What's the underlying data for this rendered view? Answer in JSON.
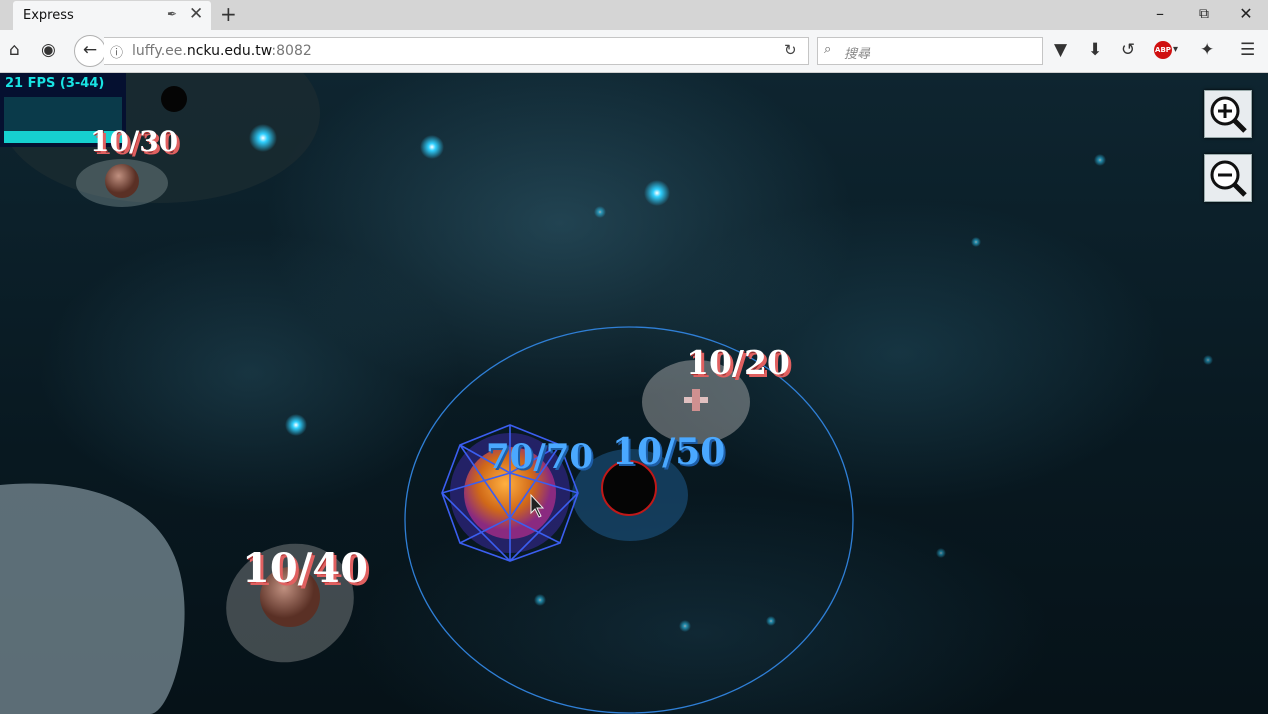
{
  "browser": {
    "tab_title": "Express",
    "url_host_prefix": "luffy.ee.",
    "url_host_main": "ncku.edu.tw",
    "url_port": ":8082",
    "search_placeholder": "搜尋",
    "abp_label": "ABP"
  },
  "game": {
    "fps_text": "21 FPS (3-44)",
    "zoom_in": "zoom-in",
    "zoom_out": "zoom-out",
    "planets": [
      {
        "label": "10/20",
        "owner": "enemy"
      },
      {
        "label": "70/70",
        "owner": "player"
      },
      {
        "label": "10/50",
        "owner": "player"
      },
      {
        "label": "10/40",
        "owner": "enemy"
      },
      {
        "label": "10/30",
        "owner": "enemy"
      }
    ]
  },
  "colors": {
    "player": "#4aa8ff",
    "enemy_label_shadow": "#e06060",
    "fps": "#19e3e3",
    "star": "#2fd0ff"
  },
  "icons": [
    "home-icon",
    "mask-icon",
    "back-arrow-icon",
    "info-icon",
    "reload-icon",
    "search-icon",
    "pocket-icon",
    "download-icon",
    "sync-icon",
    "adblock-icon",
    "extension-icon",
    "menu-icon"
  ]
}
